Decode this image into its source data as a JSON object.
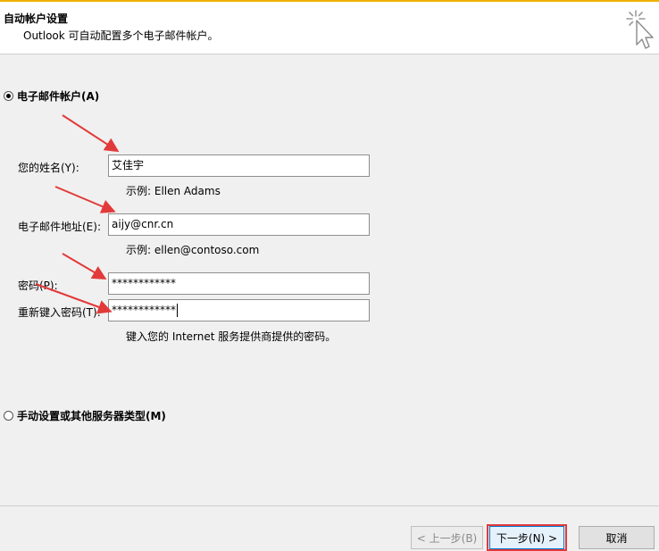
{
  "header": {
    "title": "自动帐户设置",
    "subtitle": "Outlook 可自动配置多个电子邮件帐户。",
    "icon": "wizard-cursor-icon"
  },
  "email_account": {
    "radio_label": "电子邮件帐户(A)",
    "selected": true,
    "name": {
      "label": "您的姓名(Y):",
      "value": "艾佳宇",
      "hint": "示例: Ellen Adams"
    },
    "email": {
      "label": "电子邮件地址(E):",
      "value": "aijy@cnr.cn",
      "hint": "示例: ellen@contoso.com"
    },
    "password": {
      "label": "密码(P):",
      "value": "************"
    },
    "confirm_password": {
      "label": "重新键入密码(T):",
      "value": "************"
    },
    "password_hint": "键入您的 Internet 服务提供商提供的密码。"
  },
  "manual_setup": {
    "radio_label": "手动设置或其他服务器类型(M)",
    "selected": false
  },
  "footer": {
    "back_label": "< 上一步(B)",
    "next_label": "下一步(N) >",
    "cancel_label": "取消"
  },
  "colors": {
    "annotation_red": "#e23a3a",
    "default_button_border": "#0078d7"
  }
}
